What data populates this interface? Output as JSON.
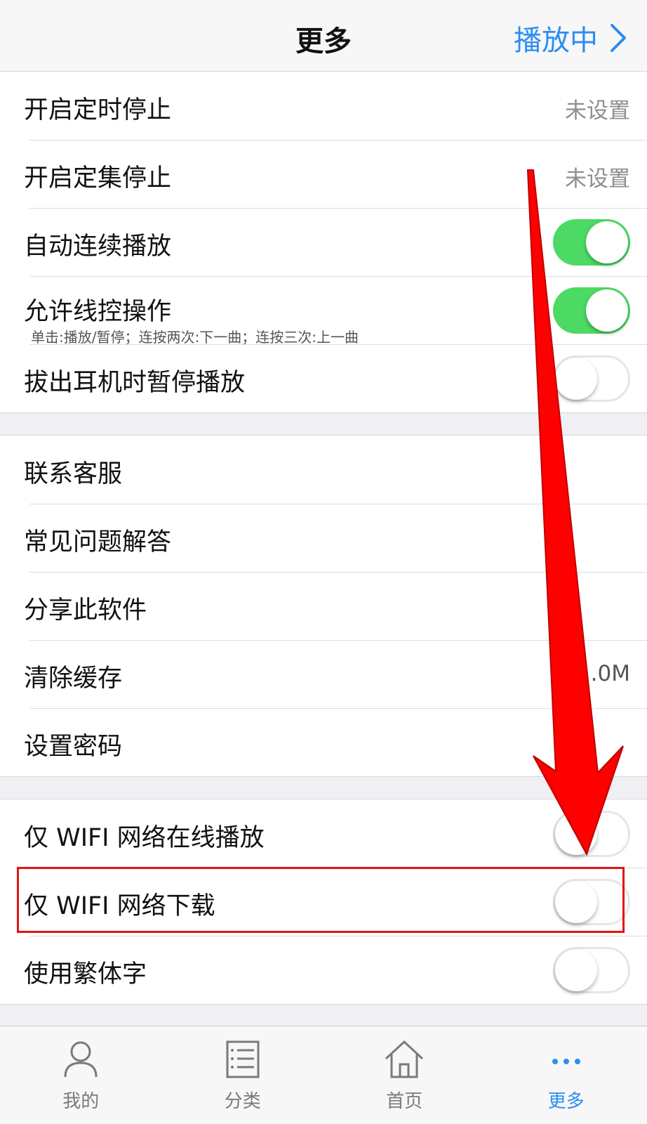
{
  "nav": {
    "title": "更多",
    "right_label": "播放中"
  },
  "group1": [
    {
      "label": "开启定时停止",
      "value": "未设置"
    },
    {
      "label": "开启定集停止",
      "value": "未设置"
    },
    {
      "label": "自动连续播放",
      "toggle": "on"
    },
    {
      "label": "允许线控操作",
      "sublabel": "单击:播放/暂停；连按两次:下一曲；连按三次:上一曲",
      "toggle": "on"
    },
    {
      "label": "拔出耳机时暂停播放",
      "toggle": "off"
    }
  ],
  "group2": [
    {
      "label": "联系客服"
    },
    {
      "label": "常见问题解答"
    },
    {
      "label": "分享此软件"
    },
    {
      "label": "清除缓存",
      "value": ".0M"
    },
    {
      "label": "设置密码"
    }
  ],
  "group3": [
    {
      "label": "仅 WIFI 网络在线播放",
      "toggle": "off"
    },
    {
      "label": "仅 WIFI 网络下载",
      "toggle": "off"
    },
    {
      "label": "使用繁体字",
      "toggle": "off"
    }
  ],
  "tabs": [
    {
      "label": "我的",
      "icon": "person-icon"
    },
    {
      "label": "分类",
      "icon": "list-icon"
    },
    {
      "label": "首页",
      "icon": "home-icon"
    },
    {
      "label": "更多",
      "icon": "more-icon",
      "active": true
    }
  ],
  "colors": {
    "accent": "#2b8ef3",
    "toggle_on": "#4cd964",
    "annotation": "#e01515"
  }
}
